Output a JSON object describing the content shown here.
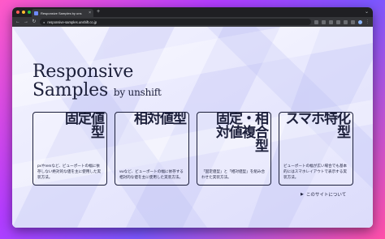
{
  "browser": {
    "tab_title": "Responsive Samples by uns",
    "tab_close": "×",
    "new_tab": "+",
    "window_menu": "⌄",
    "url": "responsive-samples.unshift.co.jp",
    "back": "←",
    "forward": "→",
    "reload": "↻",
    "menu": "⋮"
  },
  "hero": {
    "title_line1": "Responsive",
    "title_line2": "Samples",
    "by": "by unshift"
  },
  "cards": [
    {
      "title": "固定値型",
      "desc": "pxやremなど、ビューポートの幅に依存しない絶対的な値を主に使用した実装方法。"
    },
    {
      "title": "相対値型",
      "desc": "vwなど、ビューポートの幅に依存する相対的な値を主に使用した実装方法。"
    },
    {
      "title": "固定・相対値複合型",
      "desc": "「固定値型」と「相対値型」を組み合わせた実装方法。"
    },
    {
      "title": "スマホ特化型",
      "desc": "ビューポートの幅が広い場合でも基本的にはスマホレイアウトで表示する実装方法。"
    }
  ],
  "about": {
    "arrow": "▶",
    "label": "このサイトについて"
  },
  "colors": {
    "ink": "#1c1f3a",
    "page_bg": "#ecedff",
    "desktop_accent": "#b23cff"
  }
}
